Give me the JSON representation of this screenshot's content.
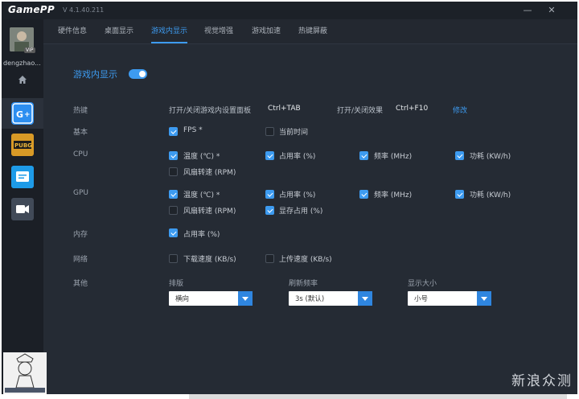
{
  "app": {
    "title": "GamePP",
    "version": "V 4.1.40.211"
  },
  "window_controls": {
    "minimize": "—",
    "close": "✕"
  },
  "tabs": [
    {
      "label": "硬件信息",
      "active": false
    },
    {
      "label": "桌面显示",
      "active": false
    },
    {
      "label": "游戏内显示",
      "active": true
    },
    {
      "label": "视觉增强",
      "active": false
    },
    {
      "label": "游戏加速",
      "active": false
    },
    {
      "label": "热键屏蔽",
      "active": false
    }
  ],
  "sidebar": {
    "username": "dengzhao...",
    "vip": "VIP",
    "icons": [
      "home-icon",
      "gamepp-plus-icon",
      "pubg-icon",
      "message-icon",
      "video-icon"
    ]
  },
  "section": {
    "title": "游戏内显示",
    "toggle_on": true
  },
  "rows": {
    "hotkey": {
      "label": "热键",
      "desc1": "打开/关闭游戏内设置面板",
      "key1": "Ctrl+TAB",
      "desc2": "打开/关闭效果",
      "key2": "Ctrl+F10",
      "modify": "修改"
    },
    "basic": {
      "label": "基本",
      "items": [
        {
          "label": "FPS *",
          "checked": true
        },
        {
          "label": "当前时间",
          "checked": false
        }
      ]
    },
    "cpu": {
      "label": "CPU",
      "items": [
        {
          "label": "温度 (℃) *",
          "checked": true
        },
        {
          "label": "占用率 (%)",
          "checked": true
        },
        {
          "label": "频率 (MHz)",
          "checked": true
        },
        {
          "label": "功耗 (KW/h)",
          "checked": true
        },
        {
          "label": "风扇转速 (RPM)",
          "checked": false
        }
      ]
    },
    "gpu": {
      "label": "GPU",
      "items": [
        {
          "label": "温度 (℃) *",
          "checked": true
        },
        {
          "label": "占用率 (%)",
          "checked": true
        },
        {
          "label": "频率 (MHz)",
          "checked": true
        },
        {
          "label": "功耗 (KW/h)",
          "checked": true
        },
        {
          "label": "风扇转速 (RPM)",
          "checked": false
        },
        {
          "label": "显存占用 (%)",
          "checked": true
        }
      ]
    },
    "memory": {
      "label": "内存",
      "items": [
        {
          "label": "占用率 (%)",
          "checked": true
        }
      ]
    },
    "network": {
      "label": "网络",
      "items": [
        {
          "label": "下载速度 (KB/s)",
          "checked": false
        },
        {
          "label": "上传速度 (KB/s)",
          "checked": false
        }
      ]
    },
    "other": {
      "label": "其他",
      "layout": {
        "label": "排版",
        "value": "横向"
      },
      "refresh": {
        "label": "刷新频率",
        "value": "3s (默认)"
      },
      "size": {
        "label": "显示大小",
        "value": "小号"
      }
    }
  },
  "watermark": "新浪众测",
  "colors": {
    "accent": "#3d9bf0",
    "background": "#252b34",
    "sidebar": "#1b1f26"
  }
}
